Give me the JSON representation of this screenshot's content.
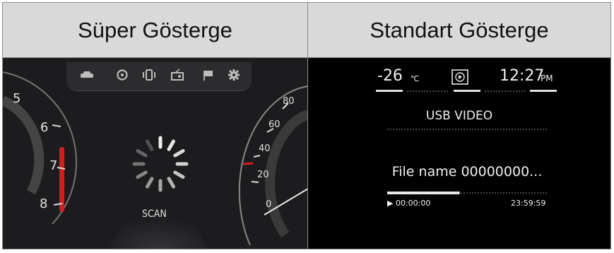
{
  "headers": {
    "left": "Süper Gösterge",
    "right": "Standart Gösterge"
  },
  "super_gauge": {
    "tachometer_ticks": [
      "5",
      "6",
      "7",
      "8"
    ],
    "speedometer_ticks": [
      "80",
      "60",
      "40",
      "20",
      "0"
    ],
    "status": "SCAN",
    "icon_names": [
      "car-icon",
      "steering-wheel-icon",
      "phone-icon",
      "radio-icon",
      "flag-icon",
      "gear-icon"
    ]
  },
  "standard_gauge": {
    "temperature": "-26",
    "temperature_unit": "℃",
    "media_icon": "play-icon",
    "time": "12:27",
    "time_suffix": "PM",
    "source": "USB VIDEO",
    "file_name": "File name 00000000...",
    "elapsed": "▶ 00:00:00",
    "total": "23:59:59",
    "progress": 0.45
  },
  "colors": {
    "header_bg": "#d9d9d9",
    "redline": "#d11f1f",
    "panel_bg": "#1c1c1e"
  }
}
